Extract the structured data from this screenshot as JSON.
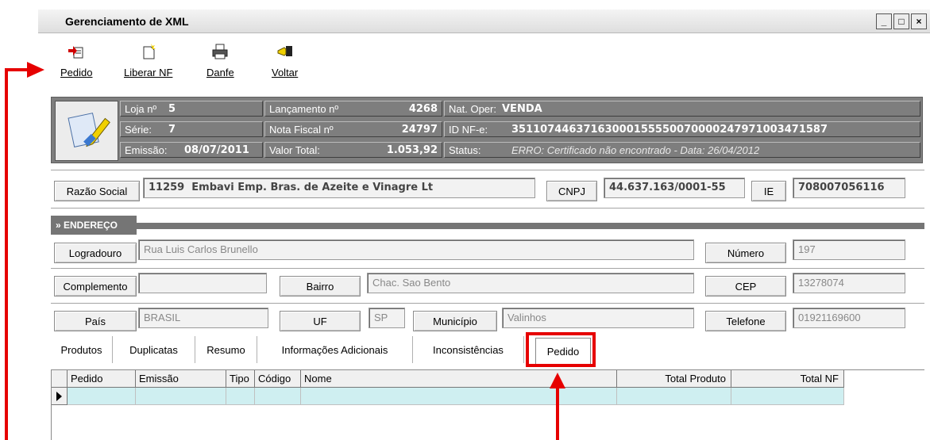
{
  "window": {
    "title": "Gerenciamento de XML",
    "controls": [
      "_",
      "□",
      "×"
    ]
  },
  "toolbar": {
    "pedido": "Pedido",
    "liberar": "Liberar NF",
    "danfe": "Danfe",
    "voltar": "Voltar",
    "icons": [
      "document-arrow-icon",
      "new-document-icon",
      "printer-icon",
      "exit-hand-icon"
    ]
  },
  "info": {
    "loja_label": "Loja nº",
    "loja_value": "5",
    "serie_label": "Série:",
    "serie_value": "7",
    "emissao_label": "Emissão:",
    "emissao_value": "08/07/2011",
    "lancamento_label": "Lançamento nº",
    "lancamento_value": "4268",
    "nota_label": "Nota Fiscal nº",
    "nota_value": "24797",
    "valor_label": "Valor Total:",
    "valor_value": "1.053,92",
    "natoper_label": "Nat. Oper:",
    "natoper_value": "VENDA",
    "idnfe_label": "ID NF-e:",
    "idnfe_value": "35110744637163000155550070000247971003471587",
    "status_label": "Status:",
    "status_value": "ERRO: Certificado não encontrado - Data: 26/04/2012"
  },
  "empresa": {
    "razao_label": "Razão Social",
    "codigo": "11259",
    "razao_value": "Embavi Emp. Bras. de Azeite e Vinagre Lt",
    "cnpj_label": "CNPJ",
    "cnpj_value": "44.637.163/0001-55",
    "ie_label": "IE",
    "ie_value": "708007056116"
  },
  "endereco": {
    "section_title": "» ENDEREÇO",
    "logradouro_label": "Logradouro",
    "logradouro_value": "Rua Luis Carlos Brunello",
    "numero_label": "Número",
    "numero_value": "197",
    "complemento_label": "Complemento",
    "complemento_value": "",
    "bairro_label": "Bairro",
    "bairro_value": "Chac. Sao Bento",
    "cep_label": "CEP",
    "cep_value": "13278074",
    "pais_label": "País",
    "pais_value": "BRASIL",
    "uf_label": "UF",
    "uf_value": "SP",
    "municipio_label": "Município",
    "municipio_value": "Valinhos",
    "telefone_label": "Telefone",
    "telefone_value": "01921169600"
  },
  "tabs": [
    "Produtos",
    "Duplicatas",
    "Resumo",
    "Informações Adicionais",
    "Inconsistências",
    "Pedido"
  ],
  "active_tab": "Pedido",
  "grid": {
    "columns": [
      "Pedido",
      "Emissão",
      "Tipo",
      "Código",
      "Nome",
      "Total Produto",
      "Total NF"
    ]
  },
  "colors": {
    "annotation": "#e60000",
    "panel": "#7e7e7e",
    "row_selected": "#cfeff1"
  }
}
